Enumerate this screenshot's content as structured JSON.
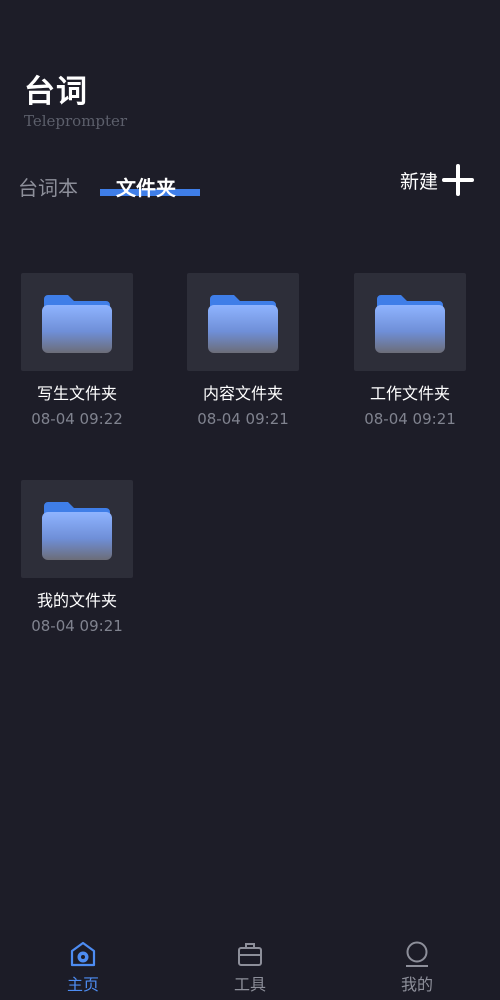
{
  "header": {
    "title": "台词",
    "subtitle": "Teleprompter"
  },
  "tabs": [
    {
      "label": "台词本",
      "active": false
    },
    {
      "label": "文件夹",
      "active": true
    }
  ],
  "toolbar": {
    "new_label": "新建"
  },
  "folders": [
    {
      "name": "写生文件夹",
      "time": "08-04 09:22"
    },
    {
      "name": "内容文件夹",
      "time": "08-04 09:21"
    },
    {
      "name": "工作文件夹",
      "time": "08-04 09:21"
    },
    {
      "name": "我的文件夹",
      "time": "08-04 09:21"
    }
  ],
  "bottom_nav": [
    {
      "label": "主页",
      "icon": "home-icon",
      "active": true
    },
    {
      "label": "工具",
      "icon": "toolbox-icon",
      "active": false
    },
    {
      "label": "我的",
      "icon": "profile-icon",
      "active": false
    }
  ],
  "colors": {
    "background": "#1d1d28",
    "accent": "#3f7ee8",
    "card": "#2d2e39",
    "muted_text": "#80838f"
  }
}
